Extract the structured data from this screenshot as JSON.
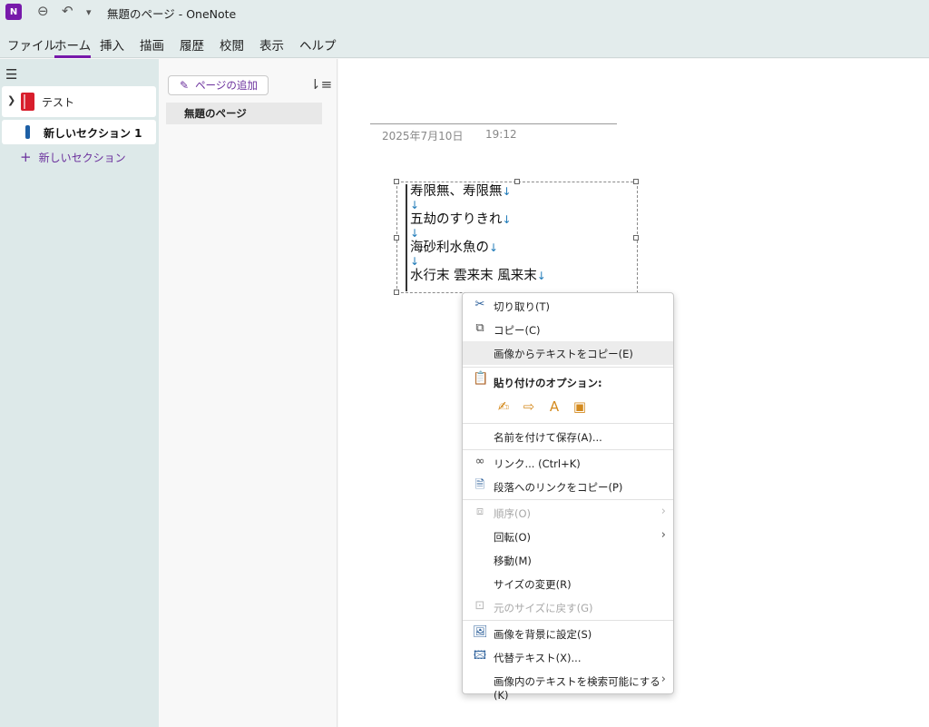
{
  "titlebar": {
    "app_icon": "onenote-logo-icon",
    "app_letter": "N",
    "title": "無題のページ  -  OneNote"
  },
  "menubar": {
    "items": [
      "ファイル",
      "ホーム",
      "挿入",
      "描画",
      "履歴",
      "校閲",
      "表示",
      "ヘルプ"
    ],
    "active": "ホーム"
  },
  "nav": {
    "notebook": "テスト",
    "section": "新しいセクション 1",
    "add_section": "新しいセクション"
  },
  "pages": {
    "add_page": "ページの追加",
    "items": [
      "無題のページ"
    ]
  },
  "page": {
    "date": "2025年7月10日",
    "time": "19:12",
    "lines": [
      "寿限無、寿限無",
      "五劫のすりきれ",
      "海砂利水魚の",
      "水行末 雲来末 風来末"
    ],
    "line_break_glyph": "↓"
  },
  "context_menu": {
    "items": {
      "cut": "切り取り(T)",
      "copy": "コピー(C)",
      "copy_text": "画像からテキストをコピー(E)",
      "paste_options": "貼り付けのオプション:",
      "save_as": "名前を付けて保存(A)...",
      "link": "リンク...  (Ctrl+K)",
      "copy_link": "段落へのリンクをコピー(P)",
      "order": "順序(O)",
      "rotate": "回転(O)",
      "move": "移動(M)",
      "resize": "サイズの変更(R)",
      "restore": "元のサイズに戻す(G)",
      "set_bg": "画像を背景に設定(S)",
      "alt_text": "代替テキスト(X)...",
      "searchable": "画像内のテキストを検索可能にする(K)"
    }
  },
  "colors": {
    "accent": "#7719aa",
    "notebook": "#d81e2c",
    "section": "#1d5fa5"
  }
}
